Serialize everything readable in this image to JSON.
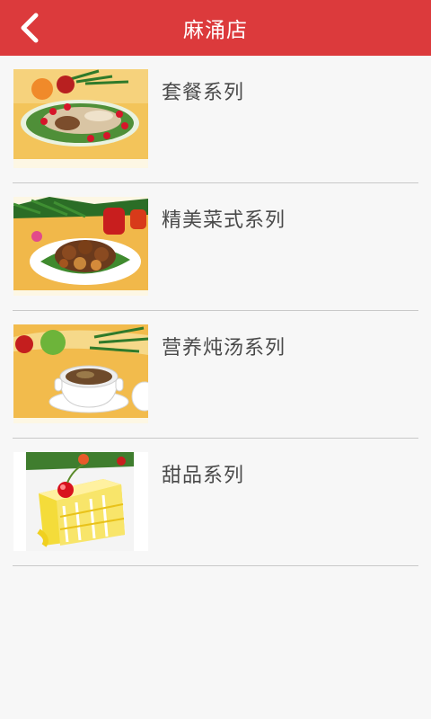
{
  "header": {
    "title": "麻涌店",
    "back_icon": "chevron-left-icon",
    "background": "#dc3a3c"
  },
  "menu": {
    "items": [
      {
        "label": "套餐系列",
        "image": "set-meal-platter-image"
      },
      {
        "label": "精美菜式系列",
        "image": "braised-dish-image"
      },
      {
        "label": "营养炖汤系列",
        "image": "stewed-soup-image"
      },
      {
        "label": "甜品系列",
        "image": "layer-cake-dessert-image"
      }
    ]
  }
}
